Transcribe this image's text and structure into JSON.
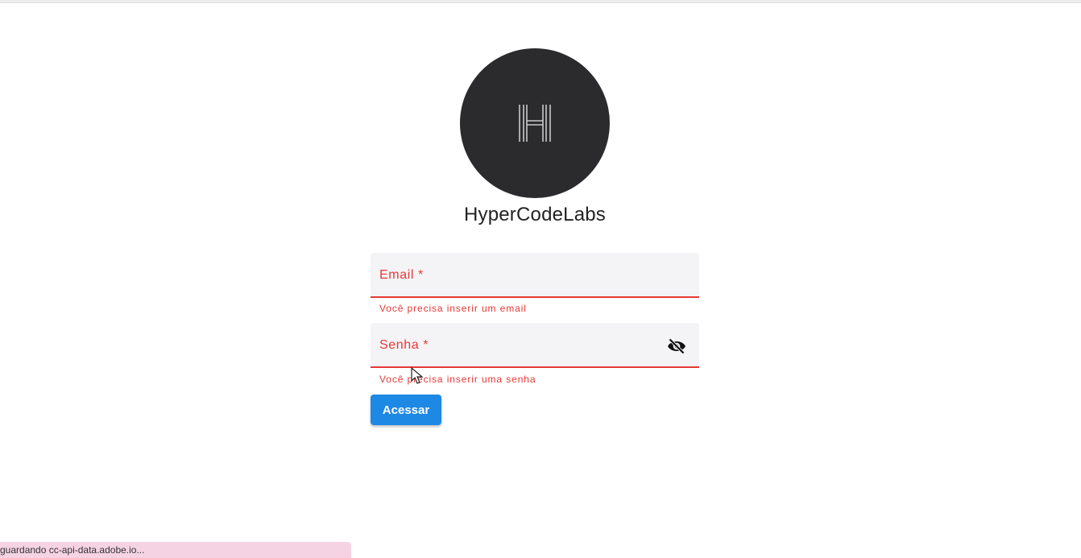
{
  "brand": {
    "name": "HyperCodeLabs",
    "logo_icon": "h-monogram-icon",
    "logo_bg_color": "#2b2a2d"
  },
  "form": {
    "email": {
      "label": "Email *",
      "value": "",
      "error": "Você precisa inserir um email"
    },
    "senha": {
      "label": "Senha *",
      "value": "",
      "error": "Você precisa inserir uma senha",
      "toggle_icon": "visibility-off-icon"
    },
    "submit_label": "Acessar"
  },
  "colors": {
    "error": "#e53935",
    "primary": "#1e88e5",
    "field_bg": "#f4f3f6"
  },
  "status_bar": {
    "text": "guardando cc-api-data.adobe.io..."
  }
}
